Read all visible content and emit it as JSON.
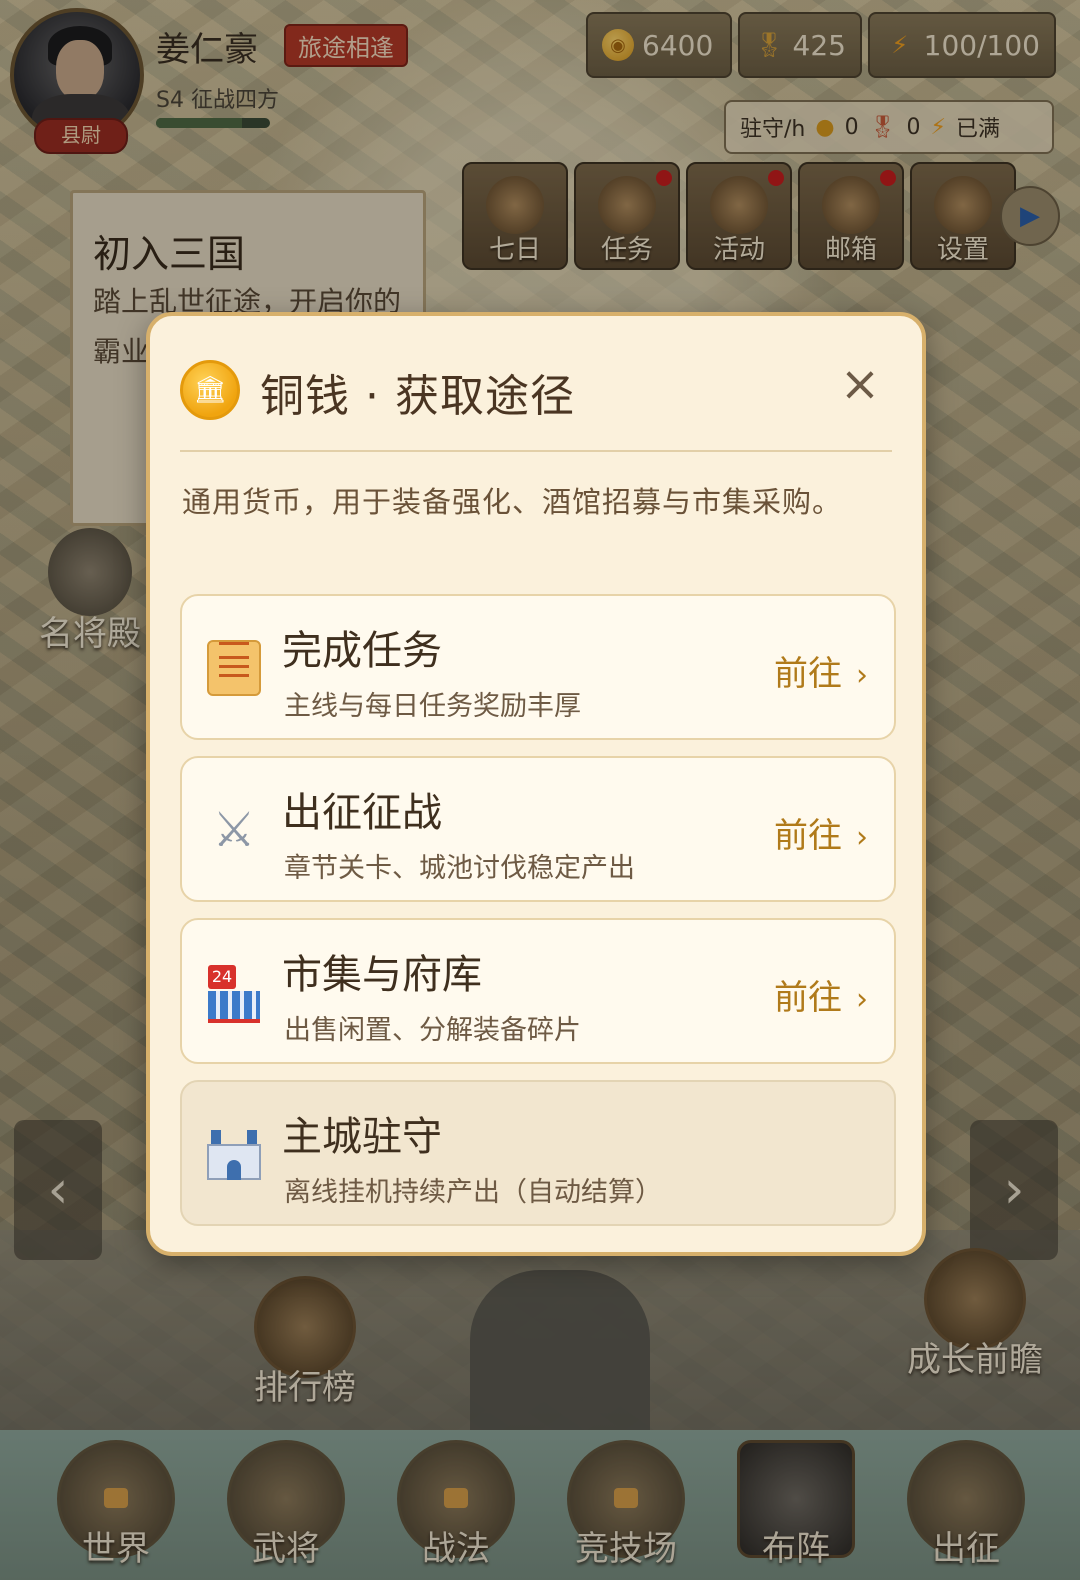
{
  "hud": {
    "player_name": "姜仁豪",
    "player_tag": "旅途相逢",
    "rank_badge": "县尉",
    "season": "S4 征战四方",
    "exp_progress": 0.75,
    "resources": [
      {
        "icon": "coin-icon",
        "value": "6400"
      },
      {
        "icon": "medal-icon",
        "value": "425"
      },
      {
        "icon": "lightning-icon",
        "value": "100/100"
      }
    ],
    "garrison": {
      "label": "驻守/h",
      "coin_value": "0",
      "medal_value": "0",
      "energy_value": "已满"
    },
    "menu": [
      {
        "label": "七日",
        "icon": "seven-days-icon",
        "badge": false
      },
      {
        "label": "任务",
        "icon": "quest-scroll-icon",
        "badge": true
      },
      {
        "label": "活动",
        "icon": "event-icon",
        "badge": true
      },
      {
        "label": "邮箱",
        "icon": "mail-icon",
        "badge": true
      },
      {
        "label": "设置",
        "icon": "settings-icon",
        "badge": false
      }
    ]
  },
  "quest_card": {
    "title": "初入三国",
    "description": "踏上乱世征途，开启你的霸业"
  },
  "map_features": {
    "hall": "名将殿",
    "ranking": "排行榜",
    "growth": "成长前瞻"
  },
  "bottom_nav": [
    {
      "label": "世界",
      "locked": true
    },
    {
      "label": "武将",
      "locked": false
    },
    {
      "label": "战法",
      "locked": true
    },
    {
      "label": "竞技场",
      "locked": true
    },
    {
      "label": "布阵",
      "locked": false,
      "active": true
    },
    {
      "label": "出征",
      "locked": false
    }
  ],
  "modal": {
    "title": "铜钱 · 获取途径",
    "close_symbol": "×",
    "description": "通用货币，用于装备强化、酒馆招募与市集采购。",
    "options": [
      {
        "title": "完成任务",
        "subtitle": "主线与每日任务奖励丰厚",
        "action": "前往",
        "icon": "scroll-icon"
      },
      {
        "title": "出征征战",
        "subtitle": "章节关卡、城池讨伐稳定产出",
        "action": "前往",
        "icon": "crossed-swords-icon"
      },
      {
        "title": "市集与府库",
        "subtitle": "出售闲置、分解装备碎片",
        "action": "前往",
        "icon": "store-icon"
      },
      {
        "title": "主城驻守",
        "subtitle": "离线挂机持续产出（自动结算）",
        "action": "",
        "icon": "castle-icon"
      }
    ]
  },
  "colors": {
    "modal_bg": "#fbf1dc",
    "modal_border": "#d7b06b",
    "accent_gold": "#b07a1a",
    "title_brown": "#4a3522"
  }
}
